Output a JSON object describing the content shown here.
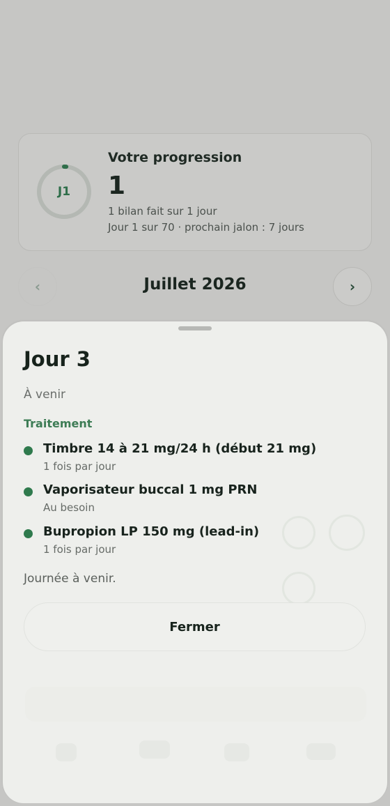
{
  "progress": {
    "ring_label": "J1",
    "title": "Votre progression",
    "value": "1",
    "summary": "1 bilan fait sur 1 jour",
    "detail": "Jour 1 sur 70 · prochain jalon : 7 jours",
    "ring_fraction": 0.014
  },
  "calendar": {
    "month": "Juillet 2026",
    "prev_icon": "‹",
    "next_icon": "›"
  },
  "sheet": {
    "title": "Jour 3",
    "status": "À venir",
    "section": "Traitement",
    "medications": [
      {
        "name": "Timbre 14 à 21 mg/24 h (début 21 mg)",
        "frequency": "1 fois par jour"
      },
      {
        "name": "Vaporisateur buccal 1 mg PRN",
        "frequency": "Au besoin"
      },
      {
        "name": "Bupropion LP 150 mg (lead-in)",
        "frequency": "1 fois par jour"
      }
    ],
    "note": "Journée à venir.",
    "close_label": "Fermer"
  },
  "colors": {
    "accent": "#2f7a4d",
    "sheet_background": "#eeefec",
    "scrim": "#c6c6c4"
  }
}
